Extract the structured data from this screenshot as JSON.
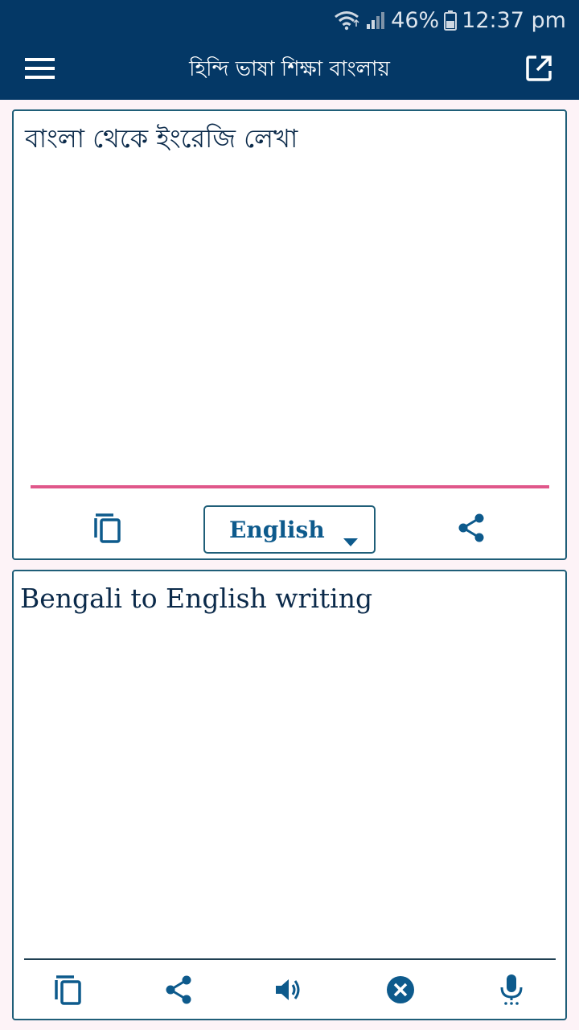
{
  "status_bar": {
    "battery": "46%",
    "time": "12:37 pm",
    "icons": [
      "wifi-icon",
      "signal-icon",
      "battery-icon"
    ]
  },
  "app_bar": {
    "title": "হিন্দি ভাষা শিক্ষা বাংলায়",
    "menu_icon": "menu-icon",
    "action_icon": "open-external-icon"
  },
  "input_card": {
    "text": "বাংলা থেকে ইংরেজি লেখা",
    "language": "English",
    "actions": [
      "copy-icon",
      "share-icon"
    ]
  },
  "output_card": {
    "text": "Bengali to English writing",
    "actions": [
      "copy-icon",
      "share-icon",
      "speaker-icon",
      "clear-icon",
      "mic-icon"
    ]
  },
  "colors": {
    "primary": "#043866",
    "accent": "#e0578a",
    "icon": "#0d5a8c",
    "border": "#1f5e78",
    "background": "#fdf3f7"
  }
}
